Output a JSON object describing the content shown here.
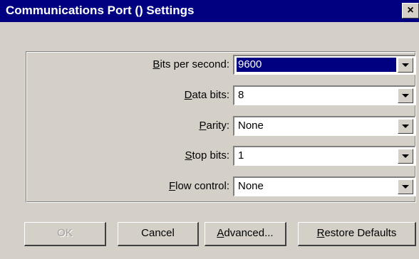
{
  "window": {
    "title": "Communications Port () Settings",
    "close_glyph": "×"
  },
  "fields": [
    {
      "label_first": "B",
      "label_rest": "its per second:",
      "value": "9600"
    },
    {
      "label_first": "D",
      "label_rest": "ata bits:",
      "value": "8"
    },
    {
      "label_first": "P",
      "label_rest": "arity:",
      "value": "None"
    },
    {
      "label_first": "S",
      "label_rest": "top bits:",
      "value": "1"
    },
    {
      "label_first": "F",
      "label_rest": "low control:",
      "value": "None"
    }
  ],
  "buttons": {
    "ok_label": "OK",
    "cancel_label": "Cancel",
    "advanced_first": "A",
    "advanced_rest": "dvanced...",
    "restore_first": "R",
    "restore_rest": "estore Defaults"
  },
  "colors": {
    "title_bar": "#000080",
    "dialog_face": "#d4d0c8",
    "selection": "#000080"
  }
}
